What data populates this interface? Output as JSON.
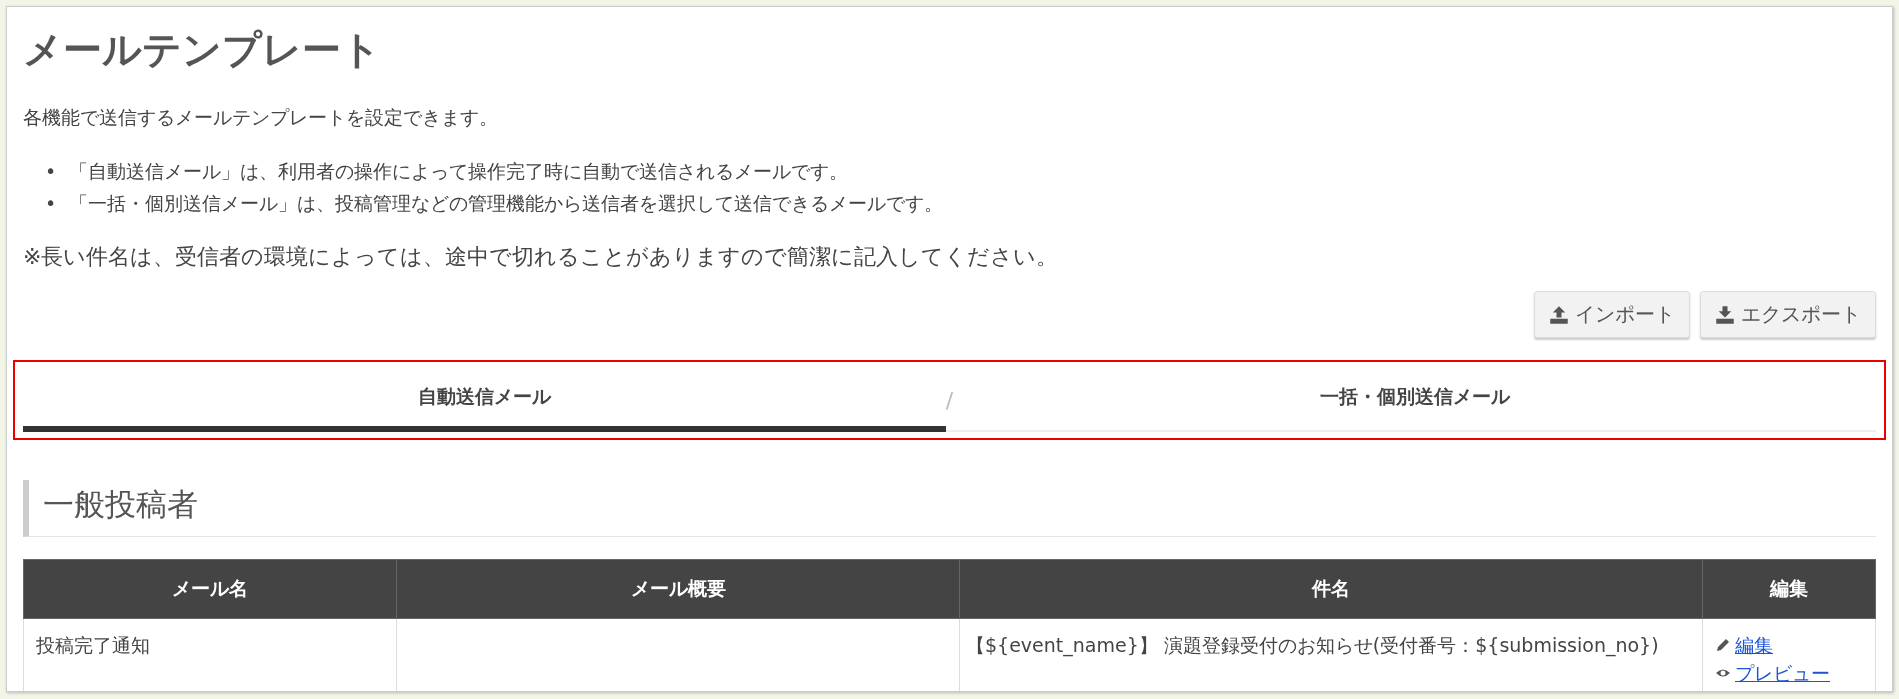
{
  "page": {
    "title": "メールテンプレート",
    "description": "各機能で送信するメールテンプレートを設定できます。",
    "bullets": [
      {
        "marker": "•",
        "text": "「自動送信メール」は、利用者の操作によって操作完了時に自動で送信されるメールです。"
      },
      {
        "marker": "•",
        "text": "「一括・個別送信メール」は、投稿管理などの管理機能から送信者を選択して送信できるメールです。"
      }
    ],
    "note": "※長い件名は、受信者の環境によっては、途中で切れることがありますので簡潔に記入してください。"
  },
  "buttons": [
    {
      "label": "インポート",
      "kind": "upload"
    },
    {
      "label": "エクスポート",
      "kind": "download"
    }
  ],
  "tabs": [
    {
      "label": "自動送信メール",
      "selected": true
    },
    {
      "label": "一括・個別送信メール",
      "selected": false
    }
  ],
  "tab_separator": "/",
  "section": {
    "heading": "一般投稿者"
  },
  "table": {
    "columns": [
      "メール名",
      "メール概要",
      "件名",
      "編集"
    ],
    "rows": [
      {
        "name": "投稿完了通知",
        "summary": "",
        "subject": "【${event_name}】 演題登録受付のお知らせ(受付番号：${submission_no})",
        "actions": [
          {
            "label": "編集",
            "kind": "edit"
          },
          {
            "label": "プレビュー",
            "kind": "preview"
          }
        ]
      }
    ]
  }
}
